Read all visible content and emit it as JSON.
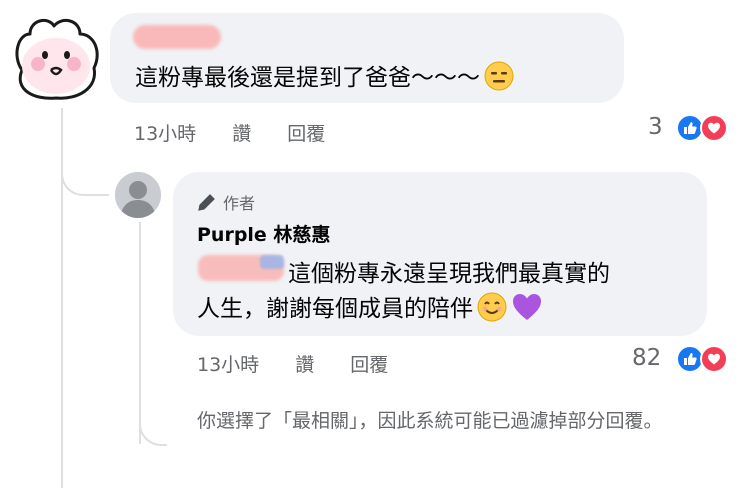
{
  "comment": {
    "text": "這粉專最後還是提到了爸爸～～～",
    "time": "13小時",
    "like_label": "讚",
    "reply_label": "回覆",
    "reaction_count": "3"
  },
  "reply": {
    "author_badge": "作者",
    "author_name": "Purple 林慈惠",
    "text_line1": "這個粉專永遠呈現我們最真實的",
    "text_line2": "人生，謝謝每個成員的陪伴",
    "time": "13小時",
    "like_label": "讚",
    "reply_label": "回覆",
    "reaction_count": "82"
  },
  "filter_notice": "你選擇了「最相關」，因此系統可能已過濾掉部分回覆。",
  "colors": {
    "bubble": "#f0f2f5",
    "secondary_text": "#65676b",
    "like_blue": "#1877f2",
    "love_red": "#f33e58",
    "thread_line": "#dddfe2"
  },
  "icons": [
    "character-avatar",
    "default-avatar",
    "expressionless-emoji",
    "smiling-emoji",
    "purple-heart-emoji",
    "pencil-icon",
    "like-reaction-icon",
    "love-reaction-icon"
  ]
}
